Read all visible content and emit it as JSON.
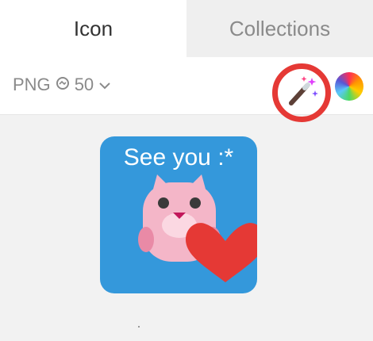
{
  "tabs": [
    {
      "label": "Icon",
      "active": true
    },
    {
      "label": "Collections",
      "active": false
    }
  ],
  "toolbar": {
    "format": "PNG",
    "size": "50",
    "magic_icon": "magic-wand-icon",
    "color_icon": "color-wheel-icon",
    "highlight_color": "#e53935"
  },
  "preview": {
    "caption": "See you :*",
    "background": "#3498db",
    "heart_color": "#e53935",
    "character_color": "#f4b6c8"
  }
}
